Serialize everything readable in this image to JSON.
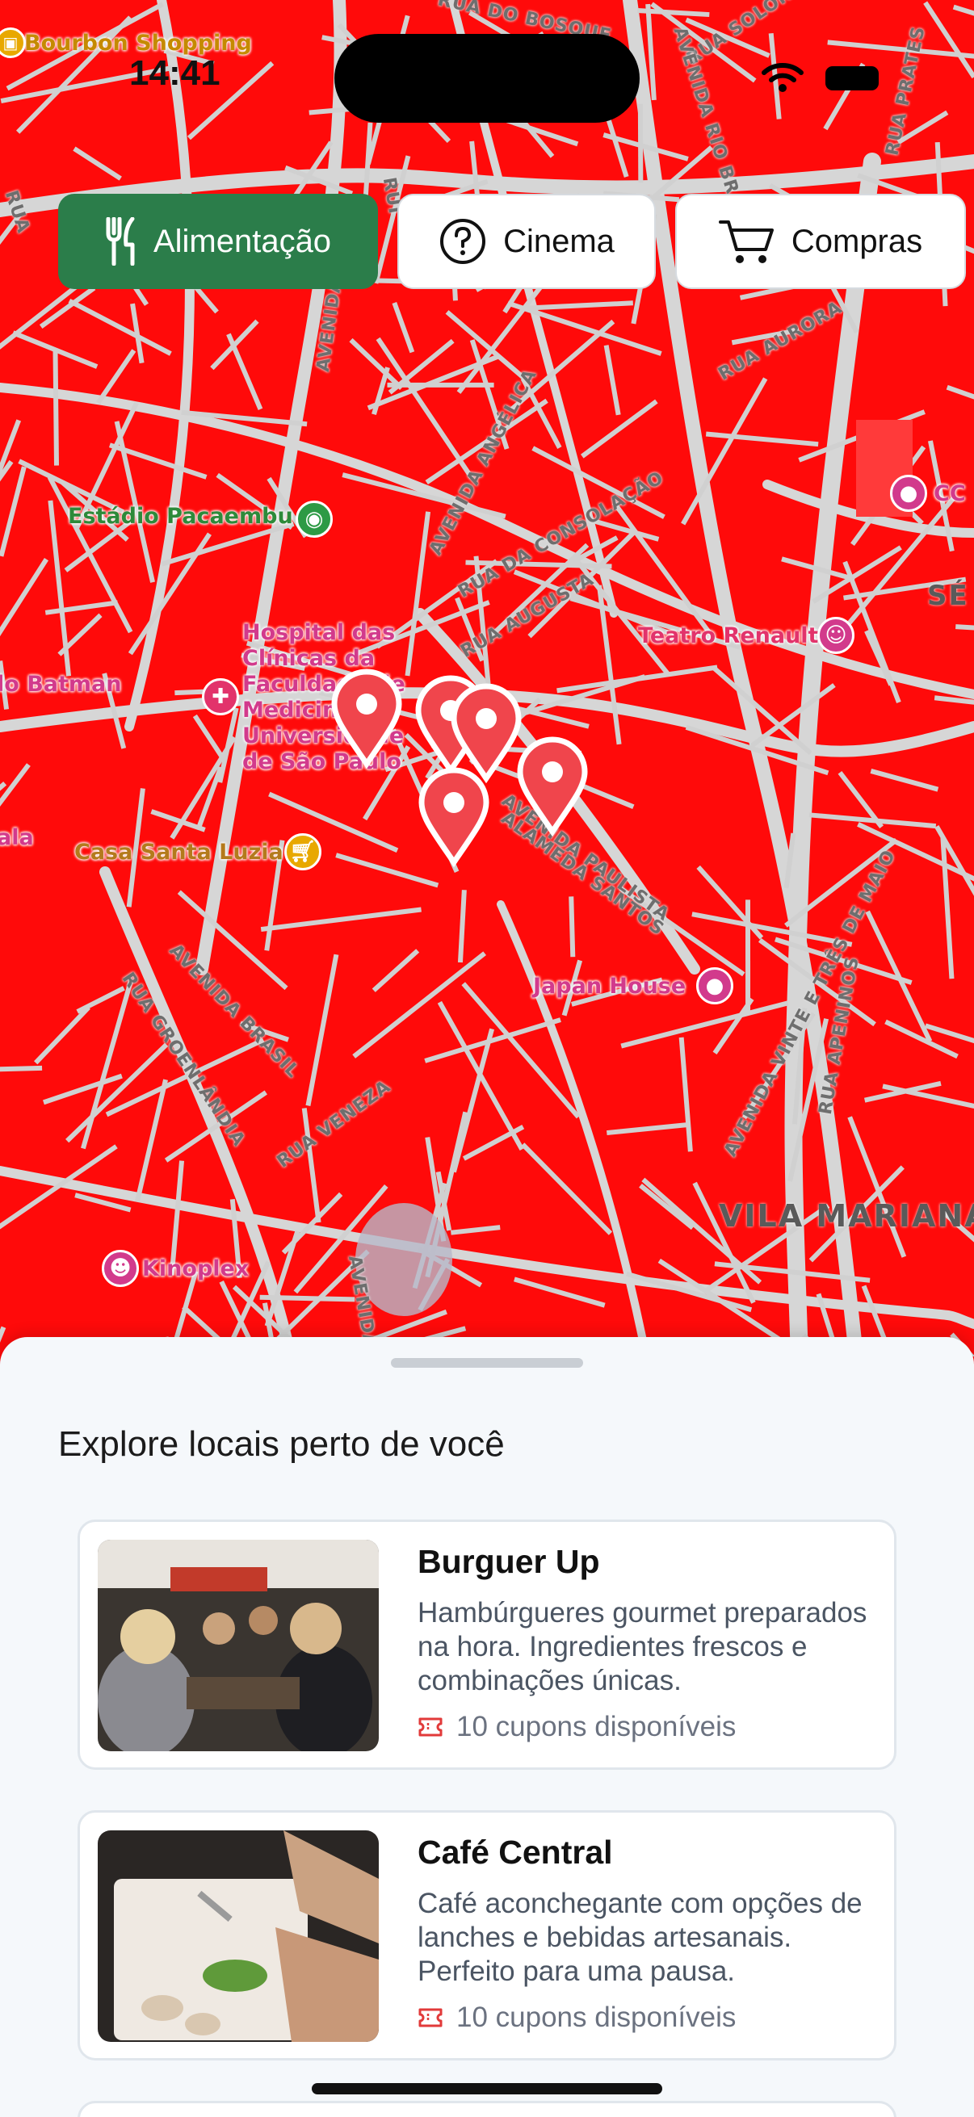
{
  "status_bar": {
    "time": "14:41"
  },
  "categories": [
    {
      "label": "Alimentação",
      "icon": "fork-knife-icon",
      "active": true
    },
    {
      "label": "Cinema",
      "icon": "question-circle-icon",
      "active": false
    },
    {
      "label": "Compras",
      "icon": "cart-icon",
      "active": false
    }
  ],
  "map": {
    "pois": {
      "bourbon": "Bourbon Shopping",
      "pacaembu": "Estádio Pacaembu",
      "hospital_1": "Hospital das",
      "hospital_2": "Clínicas da",
      "hospital_3": "Faculdade de",
      "hospital_4": "Medicina da",
      "hospital_5": "Universidade",
      "hospital_6": "de São Paulo",
      "batman": "lo Batman",
      "ala": "ala",
      "casa_santa_luzia": "Casa Santa Luzia",
      "teatro_renault": "Teatro Renault",
      "japan_house": "Japan House",
      "kinoplex": "Kinoplex",
      "ccsp": "CC",
      "se": "SÉ"
    },
    "streets": {
      "bosque": "RUA DO BOSQUE",
      "solon": "RUA SOLON",
      "prates": "RUA PRATES",
      "rio_branco": "AVENIDA RIO BRANCO",
      "aurora": "RUA AURORA",
      "angelica": "AVENIDA ANGÉLICA",
      "consolacao": "RUA DA CONSOLAÇÃO",
      "augusta": "RUA AUGUSTA",
      "paulista": "AVENIDA PAULISTA",
      "santos": "ALAMEDA SANTOS",
      "brasil": "AVENIDA BRASIL",
      "groenlandia": "RUA GROENLÂNDIA",
      "veneza": "RUA VENEZA",
      "vinte_tres": "AVENIDA VINTE E TRÊS DE MAIO",
      "apeninos": "RUA APENINOS",
      "avenida": "AVENIDA",
      "avenida2": "AVENIDA",
      "rui": "RUI",
      "rua_a": "RUA"
    },
    "district_vila_mariana": "VILA MARIANA",
    "pin_color": "#f0454c"
  },
  "sheet": {
    "title": "Explore locais perto de você",
    "places": [
      {
        "name": "Burguer Up",
        "description": "Hambúrgueres gourmet preparados na hora. Ingredientes frescos e combinações únicas.",
        "coupons": "10 cupons disponíveis"
      },
      {
        "name": "Café Central",
        "description": "Café aconchegante com opções de lanches e bebidas artesanais. Perfeito para uma pausa.",
        "coupons": "10 cupons disponíveis"
      }
    ]
  },
  "colors": {
    "map_red": "#ff0a0a",
    "road": "#d9d9d9",
    "active_chip": "#2b7d4a",
    "pin": "#f0454c",
    "coupon_icon": "#e23a3a"
  }
}
